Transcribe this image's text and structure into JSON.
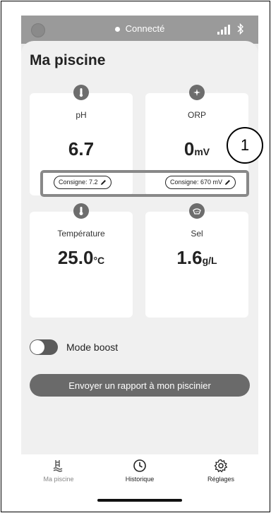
{
  "status": {
    "connection": "Connecté"
  },
  "page": {
    "title": "Ma piscine"
  },
  "cards": {
    "ph": {
      "label": "pH",
      "value": "6.7",
      "unit": "",
      "setpoint": "Consigne: 7.2",
      "icon": "thermometer-probe-icon"
    },
    "orp": {
      "label": "ORP",
      "value": "0",
      "unit": "mV",
      "setpoint": "Consigne: 670 mV",
      "icon": "sparkle-drop-icon"
    },
    "temperature": {
      "label": "Température",
      "value": "25.0",
      "unit": "°C",
      "icon": "thermometer-icon"
    },
    "salt": {
      "label": "Sel",
      "value": "1.6",
      "unit": "g/L",
      "icon": "salt-icon"
    }
  },
  "callout": {
    "number": "1"
  },
  "boost": {
    "label": "Mode boost",
    "enabled": false
  },
  "report_button": {
    "label": "Envoyer un rapport à mon piscinier"
  },
  "tabs": [
    {
      "label": "Ma piscine",
      "icon": "pool-ladder-icon",
      "active": false
    },
    {
      "label": "Historique",
      "icon": "clock-icon",
      "active": true
    },
    {
      "label": "Réglages",
      "icon": "gear-icon",
      "active": true
    }
  ],
  "colors": {
    "accent_gray": "#6a6a6a",
    "card_bg": "#ffffff",
    "sheet_bg": "#f0f0f0"
  }
}
